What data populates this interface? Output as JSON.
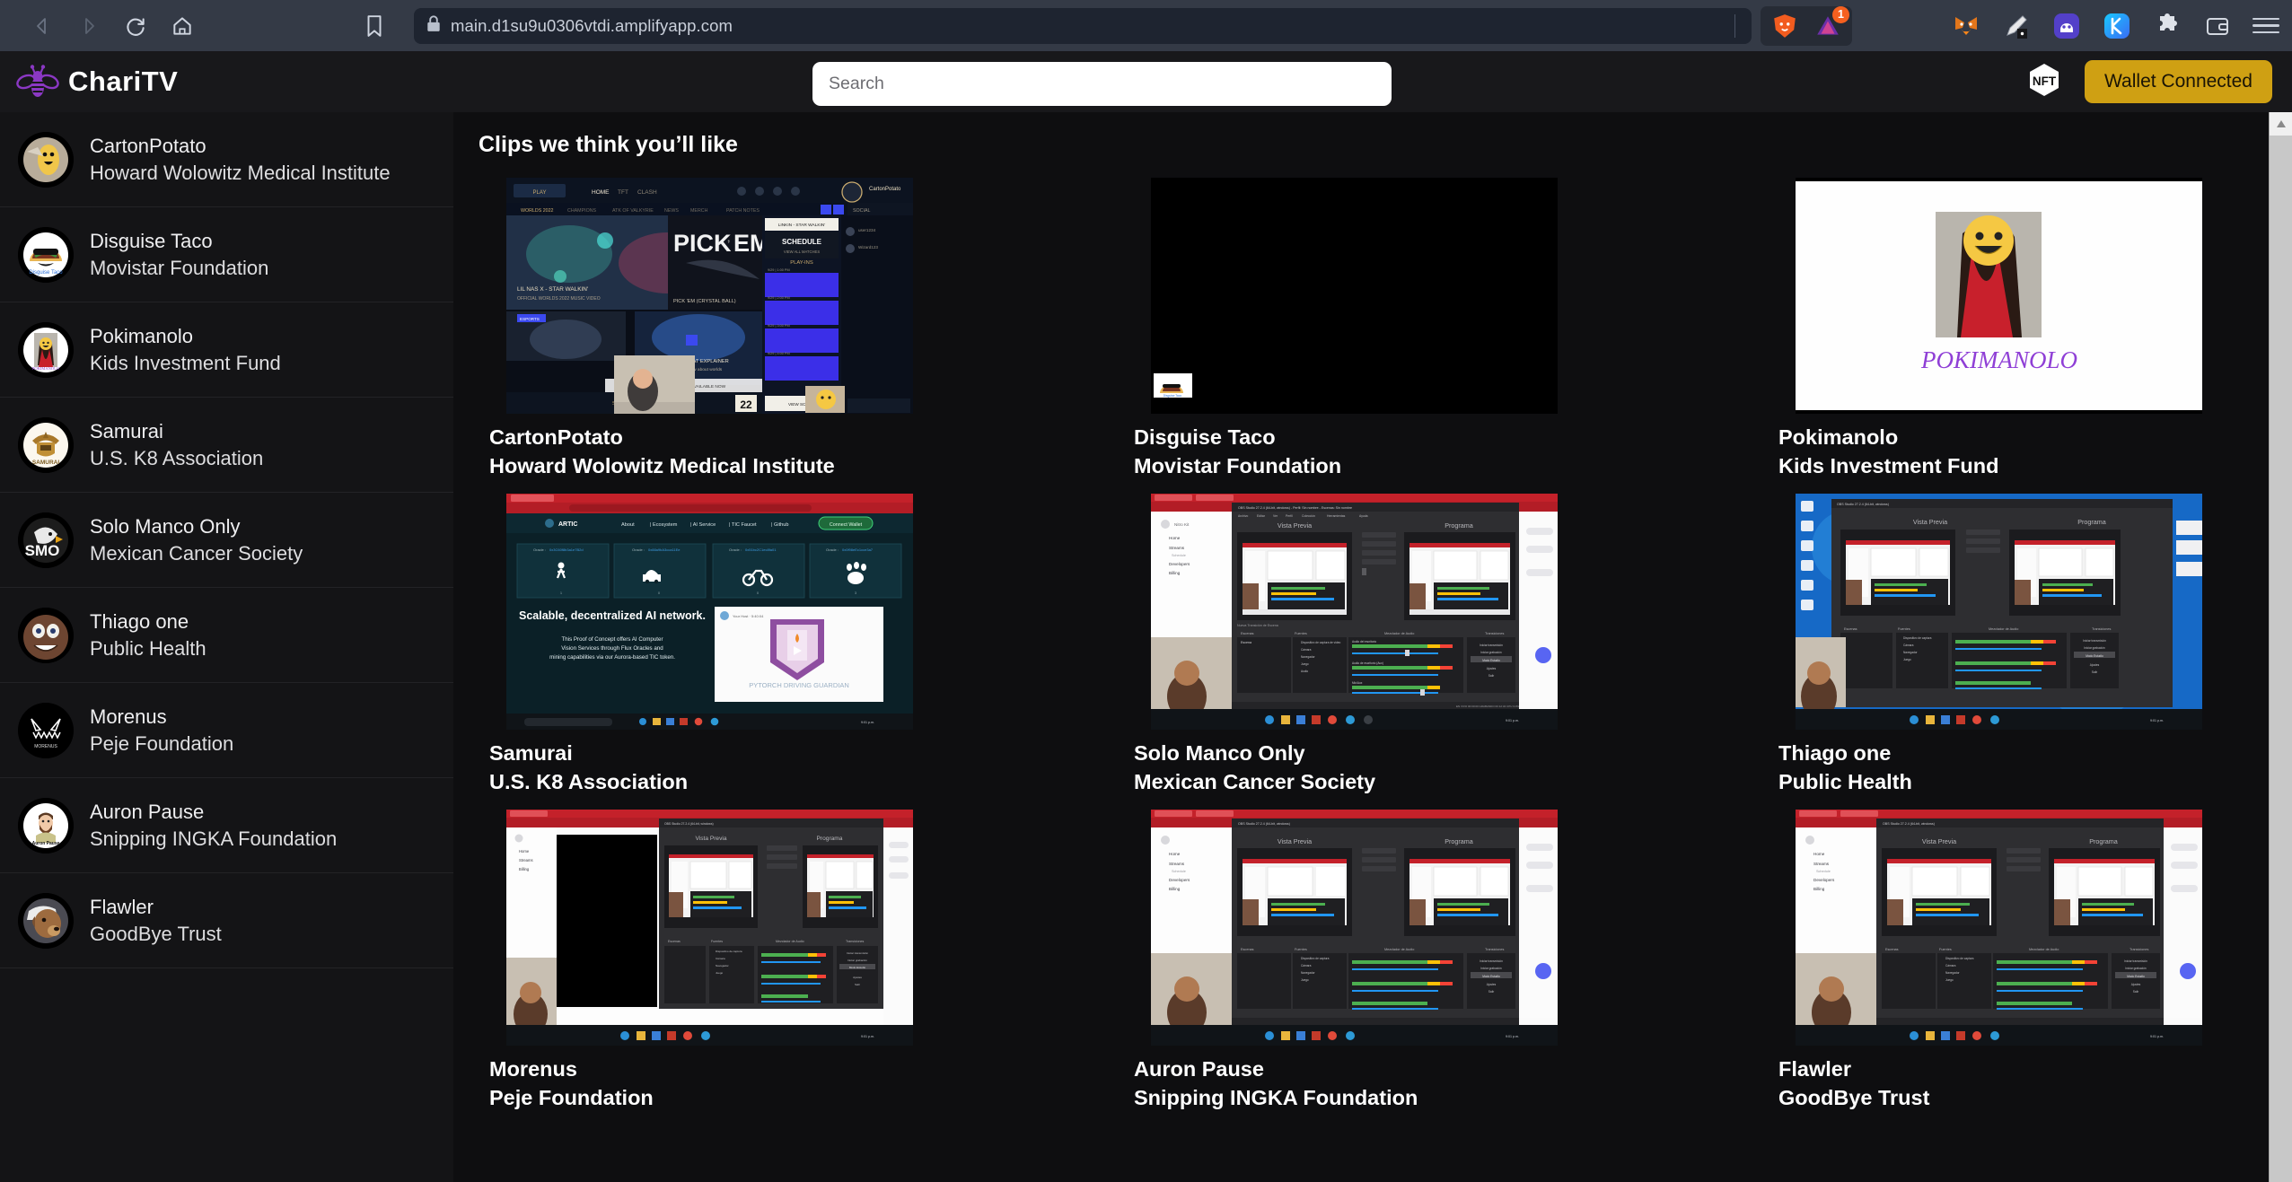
{
  "browser": {
    "url": "main.d1su9u0306vtdi.amplifyapp.com",
    "back_label": "Back",
    "forward_label": "Forward",
    "reload_label": "Reload",
    "home_label": "Home",
    "bookmark_label": "Bookmark",
    "brave_shield_label": "Brave Shields",
    "brave_rewards_badge": "1",
    "extensions": [
      {
        "name": "metamask-extension-icon",
        "label": "MetaMask"
      },
      {
        "name": "pencil-extension-icon",
        "label": "Annotate"
      },
      {
        "name": "ghost-extension-icon",
        "label": "Phantom"
      },
      {
        "name": "keplr-extension-icon",
        "label": "Keplr"
      },
      {
        "name": "puzzle-extensions-icon",
        "label": "Extensions"
      },
      {
        "name": "wallet-extension-icon",
        "label": "Wallet"
      }
    ],
    "menu_label": "Customize and control"
  },
  "header": {
    "brand": "ChariTV",
    "logo_icon": "bee-logo-icon",
    "nft_icon": "nft-hexagon-icon",
    "wallet_button": "Wallet Connected"
  },
  "search": {
    "value": "",
    "placeholder": "Search"
  },
  "sidebar": {
    "items": [
      {
        "name": "CartonPotato",
        "org": "Howard Wolowitz Medical Institute",
        "avatar": "potato-avatar"
      },
      {
        "name": "Disguise Taco",
        "org": "Movistar Foundation",
        "avatar": "taco-avatar"
      },
      {
        "name": "Pokimanolo",
        "org": "Kids Investment Fund",
        "avatar": "woman-red-dress-avatar"
      },
      {
        "name": "Samurai",
        "org": "U.S. K8 Association",
        "avatar": "samurai-avatar"
      },
      {
        "name": "Solo Manco Only",
        "org": "Mexican Cancer Society",
        "avatar": "eagle-smo-avatar"
      },
      {
        "name": "Thiago one",
        "org": "Public Health",
        "avatar": "cartoon-face-avatar"
      },
      {
        "name": "Morenus",
        "org": "Peje Foundation",
        "avatar": "morenus-monster-avatar"
      },
      {
        "name": "Auron Pause",
        "org": "Snipping INGKA Foundation",
        "avatar": "bearded-man-avatar"
      },
      {
        "name": "Flawler",
        "org": "GoodBye Trust",
        "avatar": "dog-avatar"
      }
    ]
  },
  "main": {
    "section_title": "Clips we think you’ll like",
    "cards": [
      {
        "name": "CartonPotato",
        "org": "Howard Wolowitz Medical Institute",
        "thumb": "lol-client-thumb"
      },
      {
        "name": "Disguise Taco",
        "org": "Movistar Foundation",
        "thumb": "black-taco-thumb"
      },
      {
        "name": "Pokimanolo",
        "org": "Kids Investment Fund",
        "thumb": "pokimanolo-thumb"
      },
      {
        "name": "Samurai",
        "org": "U.S. K8 Association",
        "thumb": "artic-site-thumb"
      },
      {
        "name": "Solo Manco Only",
        "org": "Mexican Cancer Society",
        "thumb": "obs-studio-thumb"
      },
      {
        "name": "Thiago one",
        "org": "Public Health",
        "thumb": "obs-blue-desktop-thumb"
      },
      {
        "name": "Morenus",
        "org": "Peje Foundation",
        "thumb": "obs-black-panel-thumb"
      },
      {
        "name": "Auron Pause",
        "org": "Snipping INGKA Foundation",
        "thumb": "obs-studio-thumb"
      },
      {
        "name": "Flawler",
        "org": "GoodBye Trust",
        "thumb": "obs-studio-thumb"
      }
    ]
  },
  "thumb_text": {
    "lol": {
      "play": "PLAY",
      "home": "HOME",
      "tft": "TFT",
      "clash": "CLASH",
      "banner1": "LIL NAS X - STAR WALKIN'",
      "banner1sub": "OFFICIAL WORLDS 2022 MUSIC VIDEO",
      "pickem": "PICK’EM",
      "pickem_cap": "PICK 'EM (CRYSTAL BALL)",
      "format": "WORLDS 2022 FORMAT EXPLAINER",
      "format_sub": "Everything you need to know about worlds",
      "schedule": "SCHEDULE",
      "playins": "PLAY-INS",
      "social": "SOCIAL",
      "user": "CartonPotato",
      "count": "22",
      "linkin": "LINKIN - STAR WALKIN'"
    },
    "artic": {
      "brand": "ARTIC",
      "nav1": "About",
      "nav2": "Ecosystem",
      "nav3": "AI Service",
      "nav4": "TIC Faucet",
      "nav5": "Github",
      "connect": "Connect Wallet",
      "headline": "Scalable, decentralized AI network.",
      "body": "This Proof of Concept offers AI Computer Vision Services through Flux Oracles and mining capabilities via our Aurora-based TIC token.",
      "guardian": "PYTORCH DRIVING GUARDIAN",
      "oracle": "Oracle :"
    },
    "obs": {
      "preview": "Vista Previa",
      "program": "Programa"
    },
    "poki": {
      "title": "POKIMANOLO"
    }
  },
  "scrollbar": {
    "up_arrow": "▲"
  },
  "colors": {
    "accent_gold": "#cfa013",
    "brand_purple": "#8b38c4",
    "app_bg": "#0e0e10",
    "sidebar_bg": "#141416",
    "header_bg": "#18181b",
    "browser_bg": "#343a46"
  }
}
